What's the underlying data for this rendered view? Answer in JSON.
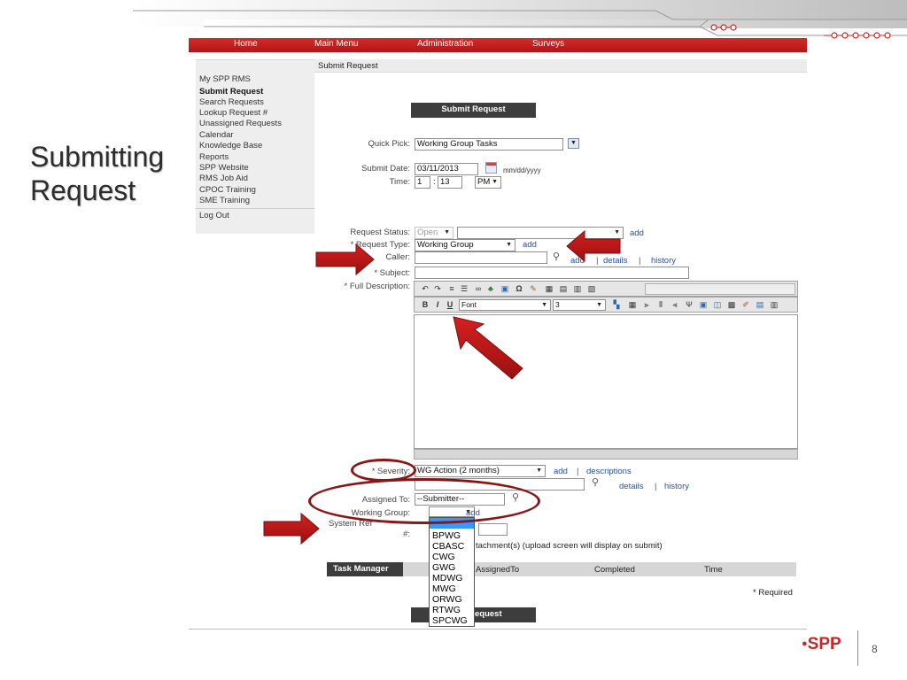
{
  "slide": {
    "title_line1": "Submitting",
    "title_line2": "Request",
    "logo_text": "SPP",
    "page_number": "8"
  },
  "nav": {
    "items": [
      "Home",
      "Main Menu",
      "Administration",
      "Surveys"
    ]
  },
  "sidebar": {
    "items": [
      "My SPP RMS",
      "Submit Request",
      "Search Requests",
      "Lookup Request #",
      "Unassigned Requests",
      "Calendar",
      "Knowledge Base",
      "Reports",
      "SPP Website",
      "RMS Job Aid",
      "CPOC Training",
      "SME Training",
      "Log Out"
    ],
    "active": "Submit Request"
  },
  "breadcrumb": "Submit Request",
  "form": {
    "header_button": "Submit Request",
    "quick_pick_label": "Quick Pick:",
    "quick_pick_value": "Working Group Tasks",
    "submit_date_label": "Submit Date:",
    "submit_date_value": "03/11/2013",
    "date_format_hint": "mm/dd/yyyy",
    "time_label": "Time:",
    "time_hour": "1",
    "time_sep": ":",
    "time_minute": "13",
    "time_ampm": "PM",
    "request_status_label": "Request Status:",
    "request_status_value": "Open",
    "request_type_label": "* Request Type:",
    "request_type_value": "Working Group",
    "caller_label": "Caller:",
    "subject_label": "* Subject:",
    "full_description_label": "* Full Description:",
    "severity_label": "* Severity:",
    "severity_value": "WG Action (2 months)",
    "assigned_to_label": "Assigned To:",
    "assigned_to_value": "--Submitter--",
    "working_group_label": "Working Group:",
    "system_ref_label": "System Ref",
    "system_ref_suffix": "#:",
    "attach_text": "tachment(s) (upload screen will display on submit)",
    "links": {
      "add": "add",
      "details": "details",
      "history": "history",
      "descriptions": "descriptions",
      "separator": "|"
    },
    "editor": {
      "font_value": "Font",
      "size_value": "3",
      "bold": "B",
      "italic": "I",
      "underline": "U"
    },
    "task_manager": {
      "label": "Task Manager",
      "columns": [
        "AssignedTo",
        "Completed",
        "Time"
      ]
    },
    "required_note": "* Required",
    "submit_button_partial": "equest"
  },
  "working_group_options": [
    "BPWG",
    "CBASC",
    "CWG",
    "GWG",
    "MDWG",
    "MWG",
    "ORWG",
    "RTWG",
    "SPCWG"
  ],
  "colors": {
    "nav_red": "#c41e1e",
    "annotation_red": "#c01818",
    "link_blue": "#2b4f9e"
  }
}
